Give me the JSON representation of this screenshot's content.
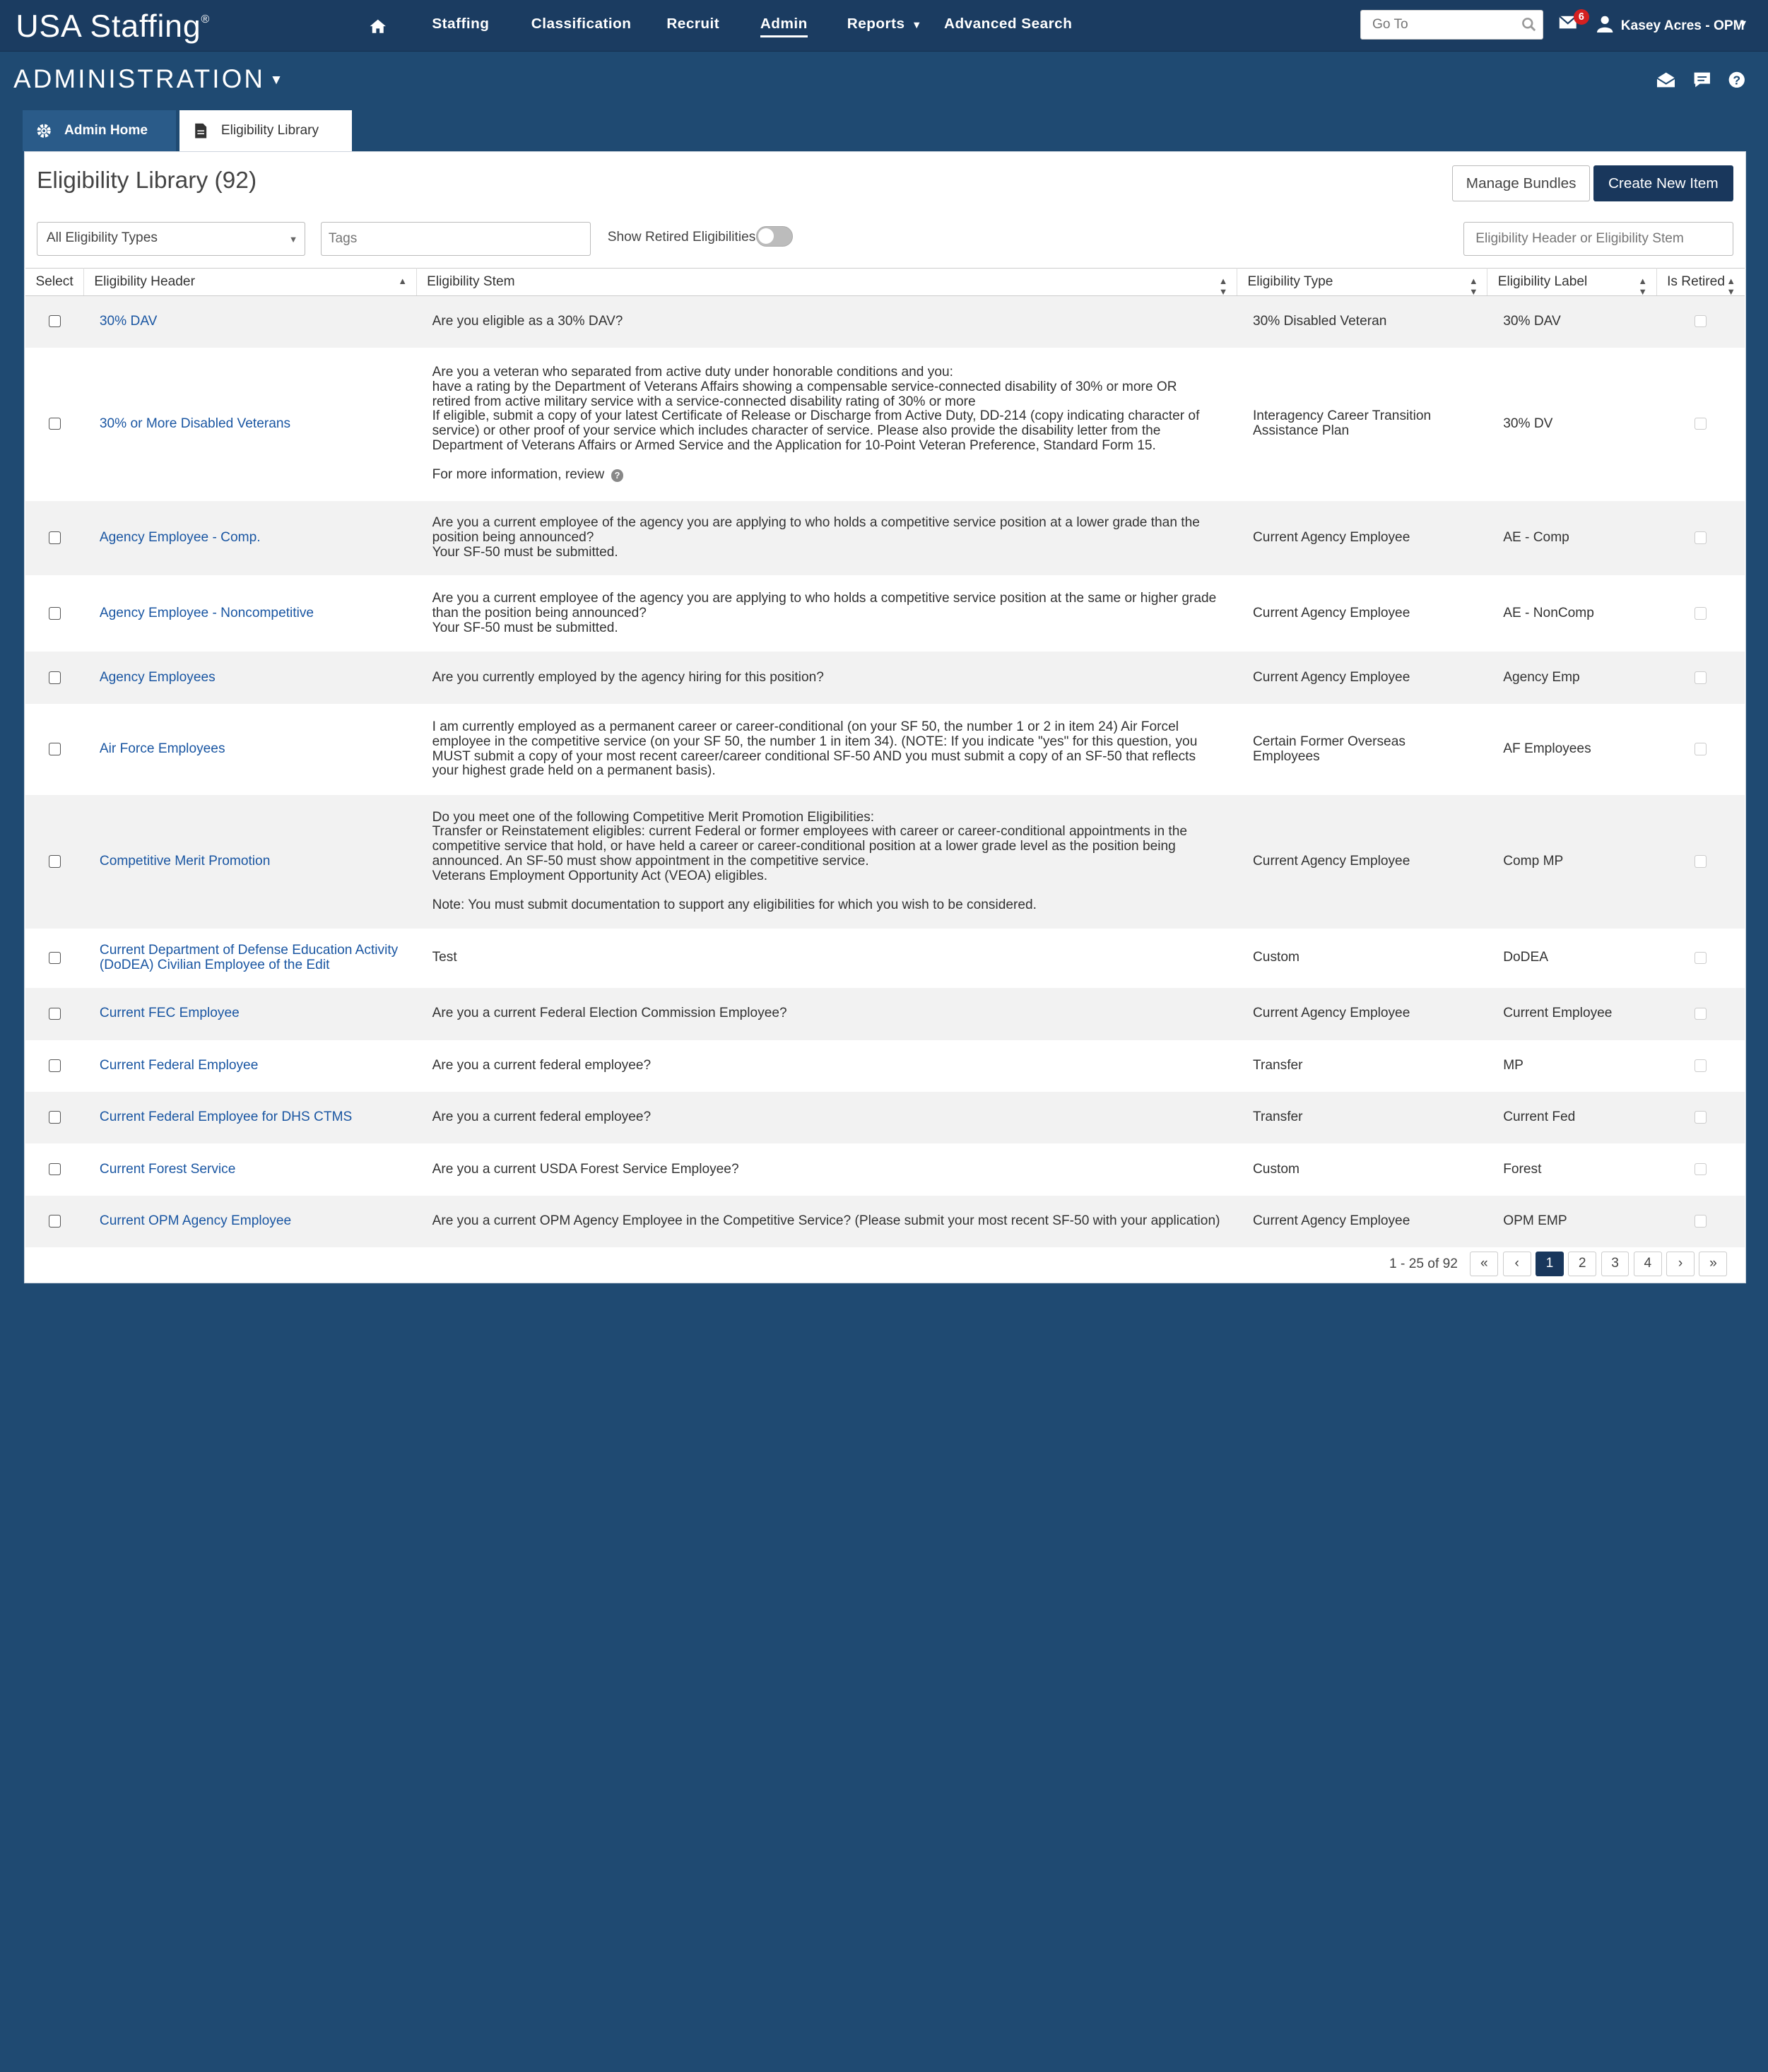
{
  "app": {
    "logo": "USA Staffing",
    "logo_mark": "®"
  },
  "nav": {
    "items": [
      "Staffing",
      "Classification",
      "Recruit",
      "Admin",
      "Reports",
      "Advanced Search"
    ]
  },
  "header": {
    "goto_placeholder": "Go To",
    "mail_count": "6",
    "user": "Kasey Acres - OPM"
  },
  "section": {
    "title": "ADMINISTRATION"
  },
  "tabs": [
    {
      "label": "Admin Home"
    },
    {
      "label": "Eligibility Library"
    }
  ],
  "panel": {
    "title": "Eligibility Library (92)",
    "manage_bundles": "Manage Bundles",
    "create_new": "Create New Item",
    "type_filter": "All Eligibility Types",
    "tags_placeholder": "Tags",
    "show_retired": "Show Retired Eligibilities",
    "search_placeholder": "Eligibility Header or Eligibility Stem"
  },
  "table": {
    "columns": [
      "Select",
      "Eligibility Header",
      "Eligibility Stem",
      "Eligibility Type",
      "Eligibility Label",
      "Is Retired"
    ],
    "rows": [
      {
        "header": "30% DAV",
        "stem": [
          "Are you eligible as a 30% DAV?"
        ],
        "type": "30% Disabled Veteran",
        "label": "30% DAV"
      },
      {
        "header": "30% or More Disabled Veterans",
        "stem": [
          "Are you a veteran who separated from active duty under honorable conditions and you:",
          "have a rating by the Department of Veterans Affairs showing a compensable service-connected disability of 30% or more OR",
          "retired from active military service with a service-connected disability rating of 30% or more",
          "If eligible, submit a copy of your latest Certificate of Release or Discharge from Active Duty, DD-214 (copy indicating character of service) or other proof of your service which includes character of service. Please also provide the disability letter from the Department of Veterans Affairs or Armed Service and the Application for 10-Point Veteran Preference, Standard Form 15."
        ],
        "more": "For more information, review",
        "type": "Interagency Career Transition Assistance Plan",
        "label": "30% DV"
      },
      {
        "header": "Agency Employee - Comp.",
        "stem": [
          "Are you a current employee of the agency you are applying to who holds a competitive service position at a lower grade than the position being announced?",
          "Your SF-50 must be submitted."
        ],
        "type": "Current Agency Employee",
        "label": "AE - Comp"
      },
      {
        "header": "Agency Employee - Noncompetitive",
        "stem": [
          "Are you a current employee of the agency you are applying to who holds a competitive service position at the same or higher grade than the position being announced?",
          "Your SF-50 must be submitted."
        ],
        "type": "Current Agency Employee",
        "label": "AE - NonComp"
      },
      {
        "header": "Agency Employees",
        "stem": [
          "Are you currently employed by the agency hiring for this position?"
        ],
        "type": "Current Agency Employee",
        "label": "Agency Emp"
      },
      {
        "header": "Air Force Employees",
        "stem": [
          "I am currently employed as a permanent career or career-conditional (on your SF 50, the number 1 or 2 in item 24) Air Forcel employee in the competitive service (on your SF 50, the number 1 in item 34). (NOTE: If you indicate \"yes\" for this question, you MUST submit a copy of your most recent career/career conditional SF-50 AND you must submit a copy of an SF-50 that reflects your highest grade held on a permanent basis)."
        ],
        "type": "Certain Former Overseas Employees",
        "label": "AF Employees"
      },
      {
        "header": "Competitive Merit Promotion",
        "stem": [
          "Do you meet one of the following Competitive Merit Promotion Eligibilities:",
          "Transfer or Reinstatement eligibles: current Federal or former employees with career or career-conditional appointments in the competitive service that hold, or have held a career or career-conditional position at a lower grade level as the position being announced. An SF-50 must show appointment in the competitive service.",
          "Veterans Employment Opportunity Act (VEOA) eligibles."
        ],
        "more": "Note: You must submit documentation to support any eligibilities for which you wish to be considered.",
        "type": "Current Agency Employee",
        "label": "Comp MP"
      },
      {
        "header": "Current Department of Defense Education Activity (DoDEA) Civilian Employee of the Edit",
        "stem": [
          "Test"
        ],
        "type": "Custom",
        "label": "DoDEA"
      },
      {
        "header": "Current FEC Employee",
        "stem": [
          "Are you a current Federal Election Commission Employee?"
        ],
        "type": "Current Agency Employee",
        "label": "Current Employee"
      },
      {
        "header": "Current Federal Employee",
        "stem": [
          "Are you a current federal employee?"
        ],
        "type": "Transfer",
        "label": "MP"
      },
      {
        "header": "Current Federal Employee for DHS CTMS",
        "stem": [
          "Are you a current federal employee?"
        ],
        "type": "Transfer",
        "label": "Current Fed"
      },
      {
        "header": "Current Forest Service",
        "stem": [
          "Are you a current USDA Forest Service Employee?"
        ],
        "type": "Custom",
        "label": "Forest"
      },
      {
        "header": "Current OPM Agency Employee",
        "stem": [
          "Are you a current OPM Agency Employee in the Competitive Service?  (Please submit your most recent SF-50 with your application)"
        ],
        "type": "Current Agency Employee",
        "label": "OPM EMP"
      }
    ]
  },
  "pager": {
    "range": "1 - 25 of 92",
    "pages": [
      "1",
      "2",
      "3",
      "4"
    ],
    "current": "1"
  }
}
